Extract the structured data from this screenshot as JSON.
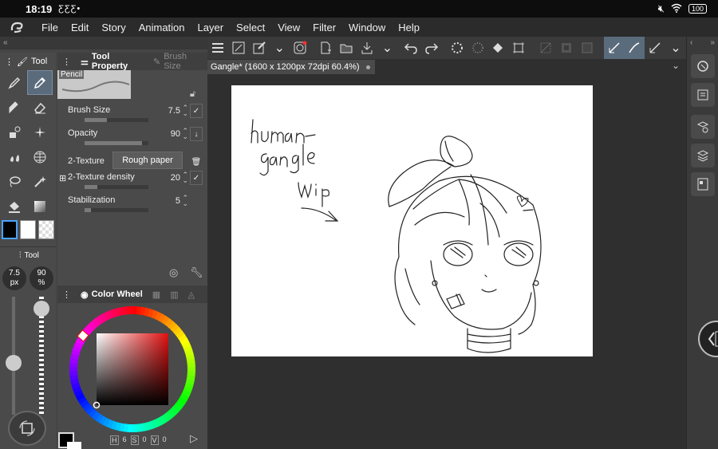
{
  "status": {
    "time": "18:19",
    "notif_icons": "ƸƸƸ•",
    "battery": "100"
  },
  "menubar": {
    "items": [
      "File",
      "Edit",
      "Story",
      "Animation",
      "Layer",
      "Select",
      "View",
      "Filter",
      "Window",
      "Help"
    ]
  },
  "left": {
    "tool_tab": "Tool",
    "tool_tab2": "Tool",
    "property_tab": "Tool Property",
    "brush_tab": "Brush Size",
    "preset_name": "Pencil",
    "props": [
      {
        "label": "Brush Size",
        "value": "7.5",
        "fill": 0.35
      },
      {
        "label": "Opacity",
        "value": "90",
        "fill": 0.9
      },
      {
        "label": "2-Texture",
        "value": "Rough paper"
      },
      {
        "label": "2-Texture density",
        "value": "20",
        "fill": 0.2
      },
      {
        "label": "Stabilization",
        "value": "5",
        "fill": 0.1
      }
    ],
    "size_bubble": "7.5\npx",
    "size_bubble_a": "7.5",
    "size_bubble_b": "px",
    "opacity_bubble_a": "90",
    "opacity_bubble_b": "%",
    "color_tab": "Color Wheel",
    "hsv": {
      "h_label": "H",
      "h": "6",
      "s_label": "S",
      "s": "0",
      "v_label": "V",
      "v": "0"
    }
  },
  "document": {
    "tab_title": "Gangle* (1600 x 1200px 72dpi 60.4%)"
  },
  "colors": {
    "accent": "#5a6b7c",
    "paper": "#ffffff",
    "bg": "#2f2f2f"
  }
}
